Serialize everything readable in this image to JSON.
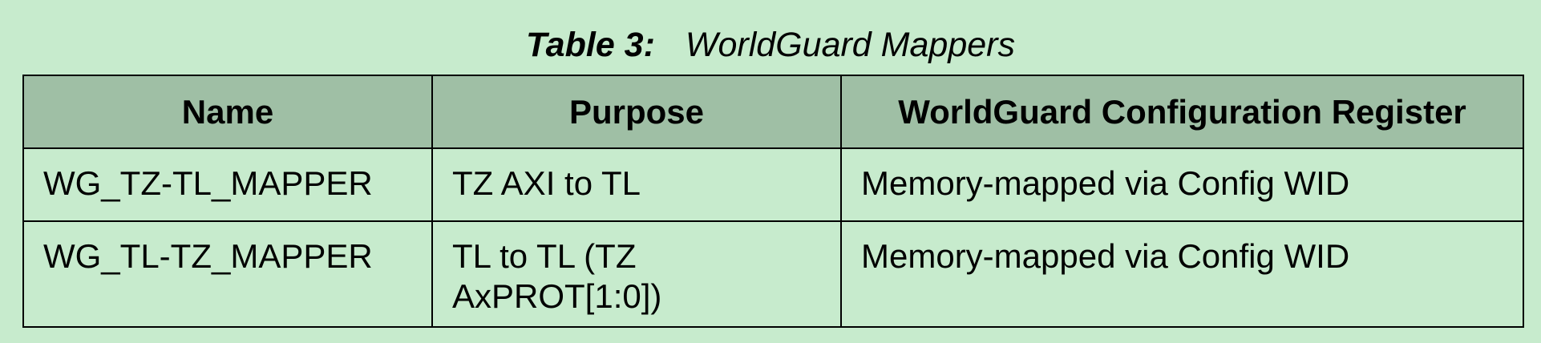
{
  "caption": {
    "label": "Table 3:",
    "title": "WorldGuard Mappers"
  },
  "table": {
    "headers": [
      "Name",
      "Purpose",
      "WorldGuard Configuration Register"
    ],
    "rows": [
      [
        "WG_TZ-TL_MAPPER",
        "TZ AXI to TL",
        "Memory-mapped via Config WID"
      ],
      [
        "WG_TL-TZ_MAPPER",
        "TL to TL (TZ AxPROT[1:0])",
        "Memory-mapped via Config WID"
      ]
    ]
  },
  "colors": {
    "background": "#c7ebcd",
    "header_background": "#9fbfa5",
    "border": "#000000"
  }
}
